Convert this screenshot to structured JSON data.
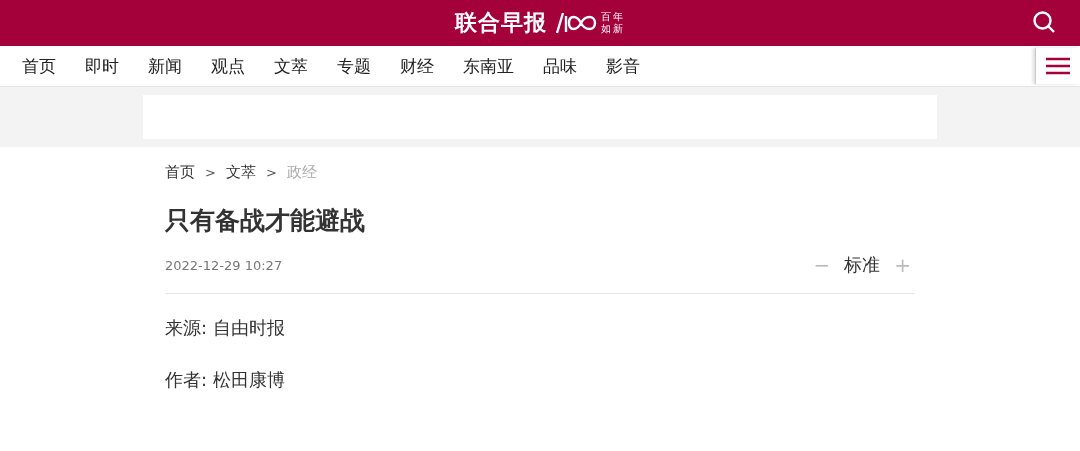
{
  "header": {
    "logo_text": "联合早报",
    "tagline": [
      "百年",
      "如新"
    ]
  },
  "nav": {
    "items": [
      "首页",
      "即时",
      "新闻",
      "观点",
      "文萃",
      "专题",
      "财经",
      "东南亚",
      "品味",
      "影音"
    ]
  },
  "breadcrumb": [
    {
      "label": "首页",
      "current": false
    },
    {
      "label": "文萃",
      "current": false
    },
    {
      "label": "政经",
      "current": true
    }
  ],
  "breadcrumb_separator": ">",
  "article": {
    "title": "只有备战才能避战",
    "date": "2022-12-29 10:27",
    "font_size": {
      "decrease": "−",
      "label": "标准",
      "increase": "+"
    },
    "meta": [
      {
        "label": "来源:",
        "value": "自由时报"
      },
      {
        "label": "作者:",
        "value": "松田康博"
      }
    ]
  }
}
